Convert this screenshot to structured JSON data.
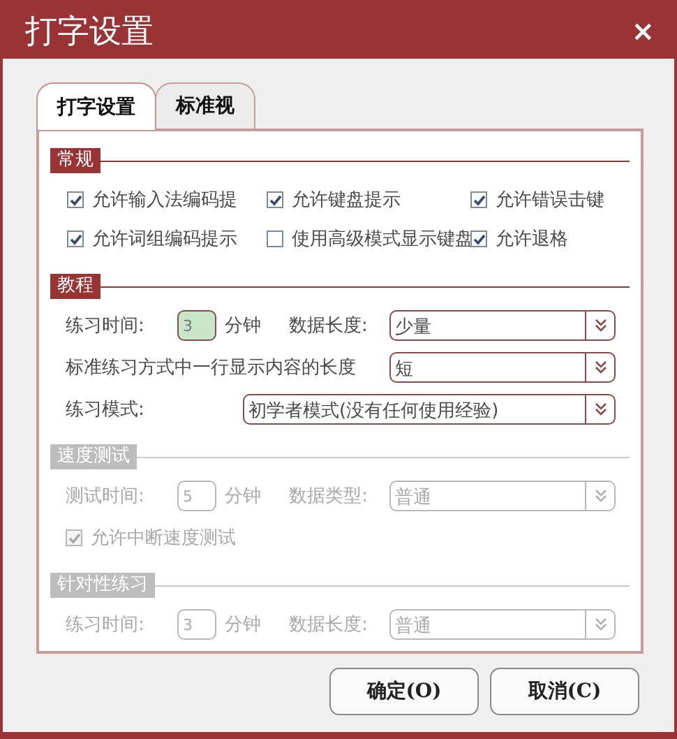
{
  "window": {
    "title": "打字设置",
    "close": "×"
  },
  "tabs": [
    {
      "label": "打字设置",
      "selected": true
    },
    {
      "label": "标准视",
      "selected": false
    }
  ],
  "sections": [
    {
      "title": "常规",
      "disabled": false,
      "items": [
        {
          "kind": "checkbox",
          "label": "允许输入法编码提",
          "checked": true
        },
        {
          "kind": "checkbox",
          "label": "允许键盘提示",
          "checked": true
        },
        {
          "kind": "checkbox",
          "label": "允许错误击键",
          "checked": true
        },
        {
          "kind": "checkbox",
          "label": "允许词组编码提示",
          "checked": true
        },
        {
          "kind": "checkbox",
          "label": "使用高级模式显示键盘",
          "checked": false
        },
        {
          "kind": "checkbox",
          "label": "允许退格",
          "checked": true
        }
      ]
    },
    {
      "title": "教程",
      "disabled": false,
      "items": [
        {
          "kind": "time",
          "label": "练习时间:",
          "value": "3",
          "highlighted": true,
          "unit": "分钟",
          "select_label": "数据长度:",
          "select_value": "少量"
        },
        {
          "kind": "select",
          "label": "标准练习方式中一行显示内容的长度",
          "value": "短"
        },
        {
          "kind": "wide_select",
          "label": "练习模式:",
          "value": "初学者模式(没有任何使用经验)"
        }
      ]
    },
    {
      "title": "速度测试",
      "disabled": true,
      "items": [
        {
          "kind": "time",
          "label": "测试时间:",
          "value": "5",
          "highlighted": false,
          "unit": "分钟",
          "select_label": "数据类型:",
          "select_value": "普通"
        },
        {
          "kind": "checkbox_row",
          "label": "允许中断速度测试",
          "checked": true
        }
      ]
    },
    {
      "title": "针对性练习",
      "disabled": true,
      "items": [
        {
          "kind": "time",
          "label": "练习时间:",
          "value": "3",
          "highlighted": false,
          "unit": "分钟",
          "select_label": "数据长度:",
          "select_value": "普通"
        }
      ]
    }
  ],
  "buttons": [
    {
      "label": "确定(O)"
    },
    {
      "label": "取消(C)"
    }
  ]
}
